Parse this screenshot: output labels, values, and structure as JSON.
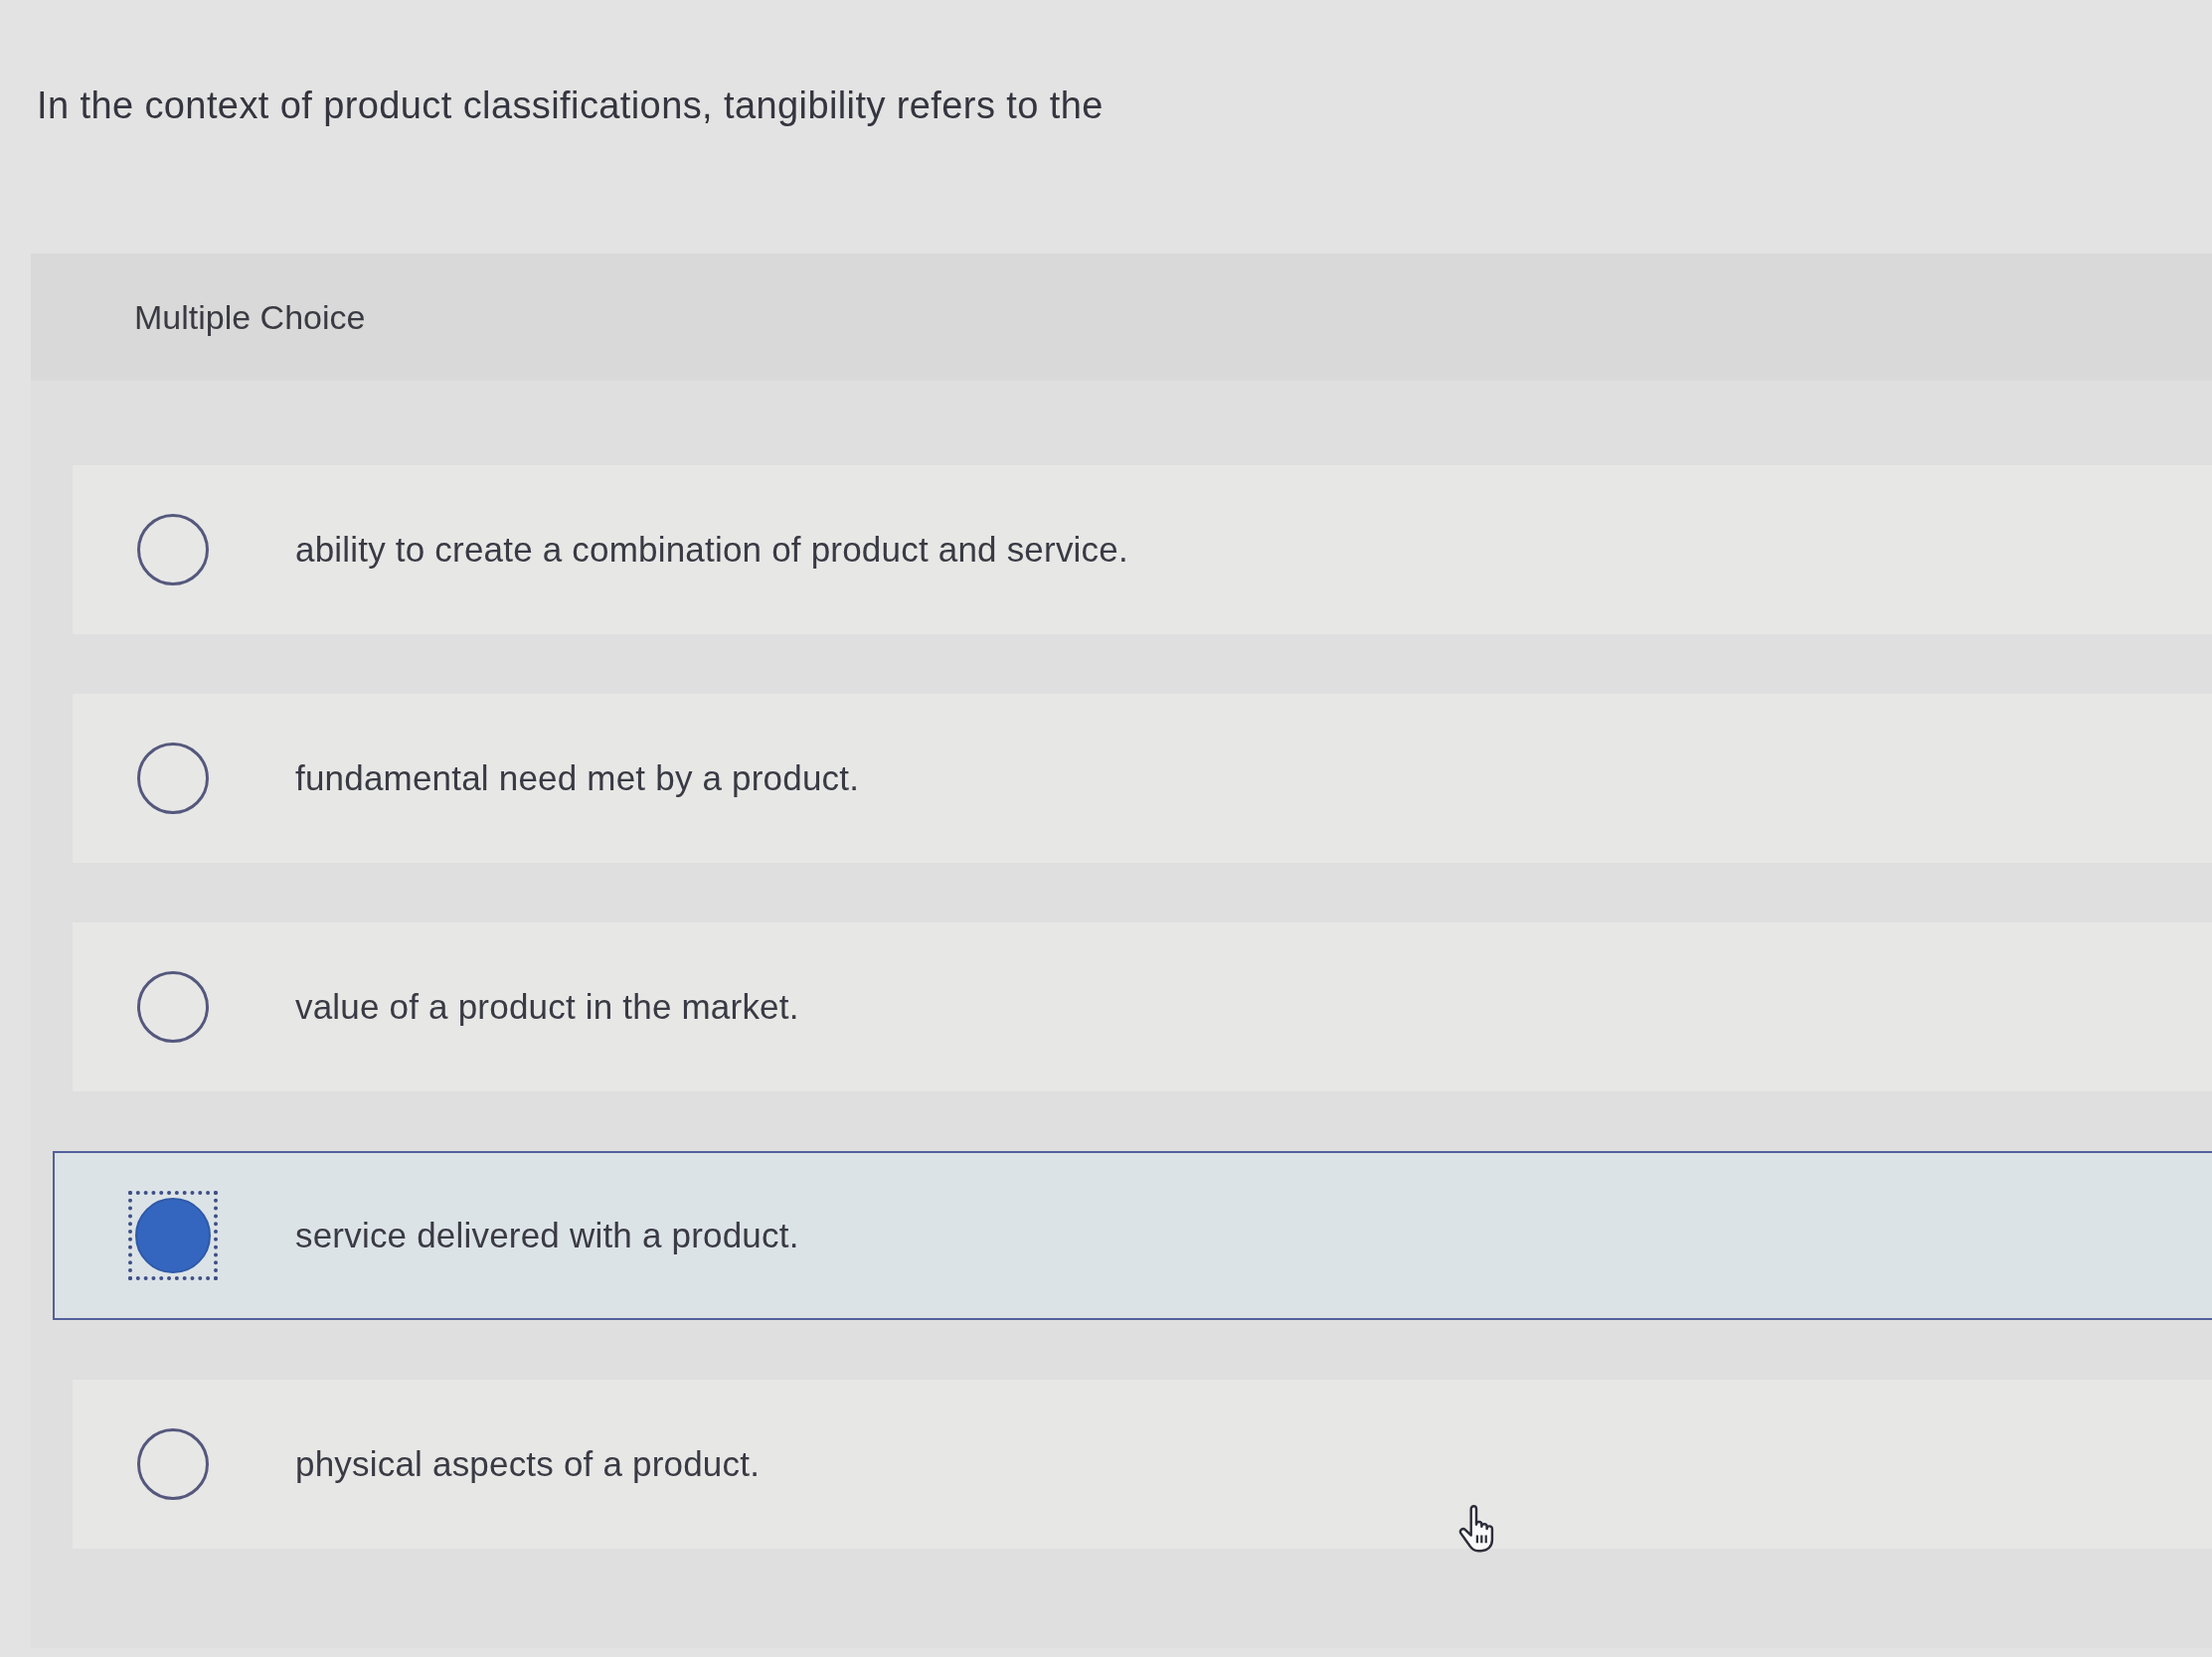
{
  "question": {
    "text": "In the context of product classifications, tangibility refers to the"
  },
  "panel": {
    "title": "Multiple Choice"
  },
  "options": [
    {
      "label": "ability to create a combination of product and service.",
      "selected": false
    },
    {
      "label": "fundamental need met by a product.",
      "selected": false
    },
    {
      "label": "value of a product in the market.",
      "selected": false
    },
    {
      "label": "service delivered with a product.",
      "selected": true
    },
    {
      "label": "physical aspects of a product.",
      "selected": false
    }
  ]
}
